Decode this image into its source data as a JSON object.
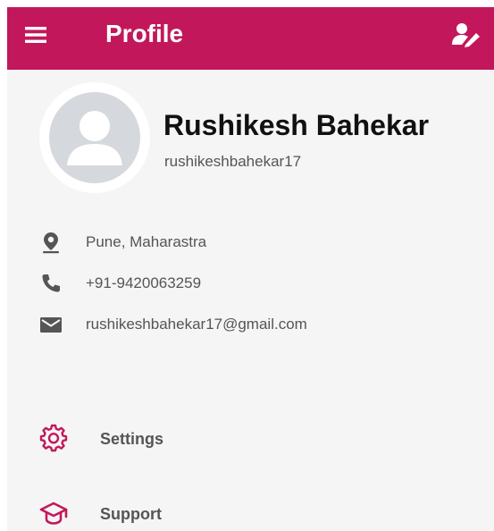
{
  "app_bar": {
    "title": "Profile",
    "menu_icon": "hamburger-menu-icon",
    "action_icon": "edit-profile-icon",
    "color": "#c2185b"
  },
  "profile": {
    "avatar_icon": "person-avatar-icon",
    "name": "Rushikesh Bahekar",
    "username": "rushikeshbahekar17"
  },
  "contact": [
    {
      "icon": "location-pin-icon",
      "text": "Pune, Maharastra"
    },
    {
      "icon": "phone-icon",
      "text": "+91-9420063259"
    },
    {
      "icon": "email-icon",
      "text": "rushikeshbahekar17@gmail.com"
    }
  ],
  "menu": [
    {
      "icon": "gear-icon",
      "label": "Settings"
    },
    {
      "icon": "graduation-cap-icon",
      "label": "Support"
    }
  ]
}
